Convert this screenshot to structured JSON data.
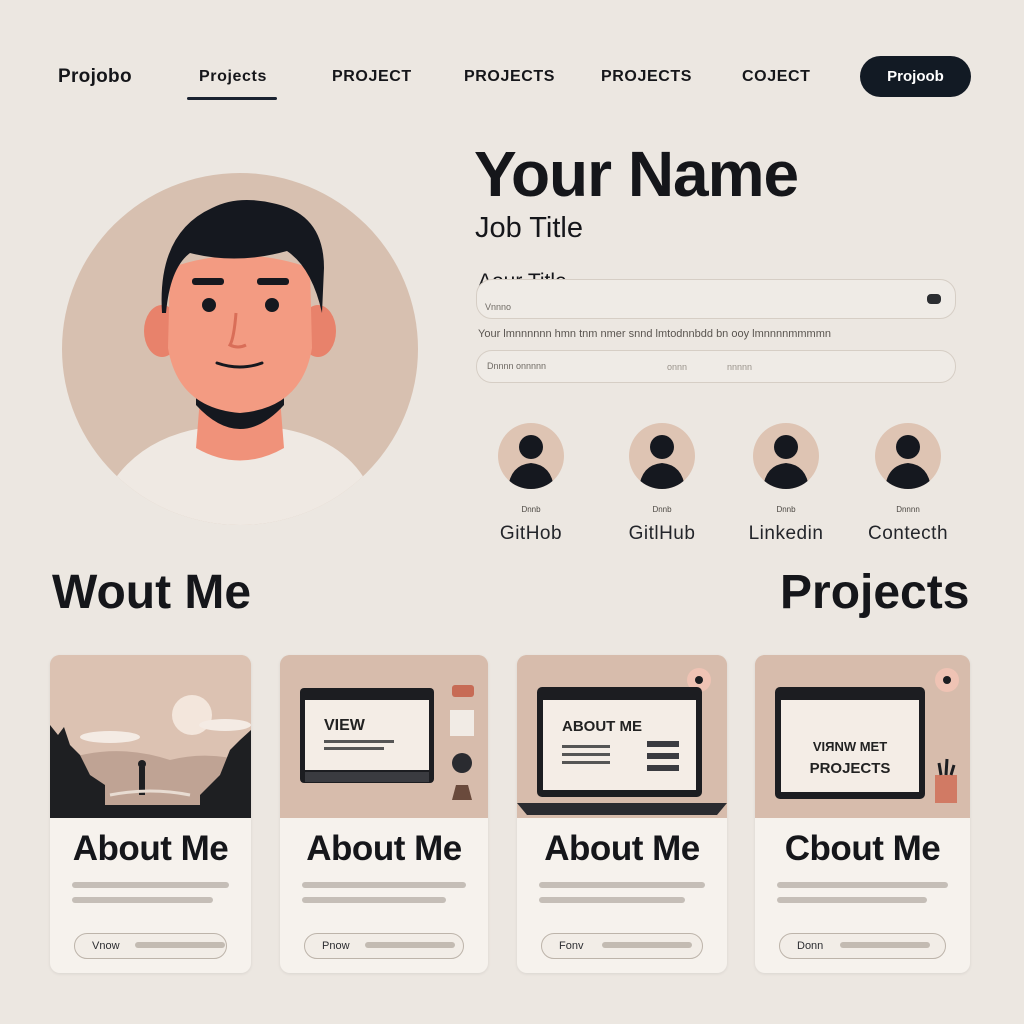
{
  "nav": {
    "brand": "Projobo",
    "links": [
      "Projects",
      "PROJECT",
      "PROJECTS",
      "PROJECTS",
      "COJECT"
    ],
    "button": "Projoob"
  },
  "hero": {
    "name": "Your Name",
    "job_title": "Job Title",
    "about_title": "Aour Title",
    "field1_placeholder": "Vnnno",
    "bio": "Your lmnnnnnn hmn tnm nmer snnd lmtodnnbdd bn ooy lmnnnnmmmmn",
    "field2_placeholder": "Dnnnn onnnnn",
    "field2_value1": "onnn",
    "field2_value2": "nnnnn"
  },
  "social": [
    {
      "tiny": "Dnnb",
      "label": "GitHob"
    },
    {
      "tiny": "Dnnb",
      "label": "GitlHub"
    },
    {
      "tiny": "Dnnb",
      "label": "Linkedin"
    },
    {
      "tiny": "Dnnnn",
      "label": "Contecth"
    }
  ],
  "sections": {
    "about_heading": "Wout Me",
    "projects_heading": "Projects"
  },
  "cards": [
    {
      "title": "About Me",
      "button": "Vnow",
      "screen": ""
    },
    {
      "title": "About Me",
      "button": "Pnow",
      "screen": "VIEW"
    },
    {
      "title": "About Me",
      "button": "Fonv",
      "screen": "ABOUT ME"
    },
    {
      "title": "Cbout Me",
      "button": "Donn",
      "screen_line1": "VIЯNW МЕТ",
      "screen_line2": "PROJECTS"
    }
  ],
  "colors": {
    "background": "#ece7e1",
    "accent_dark": "#121a24",
    "card_thumb": "#d9c2b3",
    "skin": "#f0927a"
  }
}
